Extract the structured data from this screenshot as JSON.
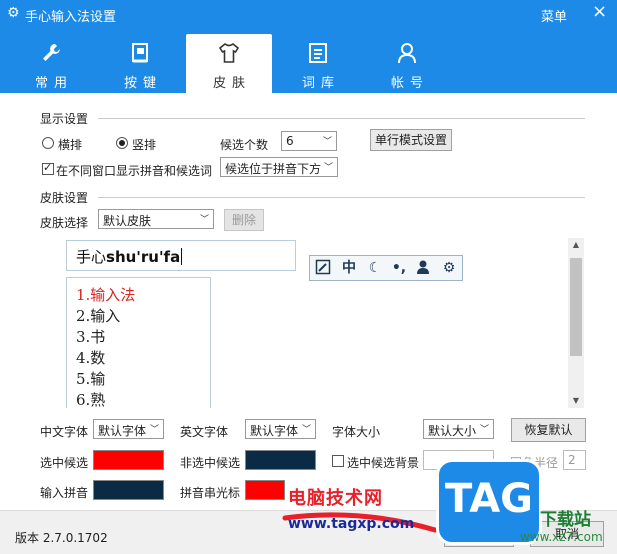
{
  "window": {
    "title": "手心输入法设置",
    "menu_label": "菜单",
    "close_glyph": "×"
  },
  "tabs": [
    {
      "label": "常用",
      "icon": "wrench-icon"
    },
    {
      "label": "按键",
      "icon": "keyboard-icon"
    },
    {
      "label": "皮肤",
      "icon": "tshirt-icon",
      "active": true
    },
    {
      "label": "词库",
      "icon": "book-icon"
    },
    {
      "label": "帐号",
      "icon": "user-icon"
    }
  ],
  "display": {
    "section_title": "显示设置",
    "horizontal_label": "横排",
    "vertical_label": "竖排",
    "orientation_selected": "竖排",
    "candidate_count_label": "候选个数",
    "candidate_count_value": "6",
    "single_line_button": "单行模式设置",
    "show_in_window_label": "在不同窗口显示拼音和候选词",
    "show_in_window_checked": true,
    "position_value": "候选位于拼音下方"
  },
  "skin": {
    "section_title": "皮肤设置",
    "select_label": "皮肤选择",
    "select_value": "默认皮肤",
    "delete_button": "删除"
  },
  "preview": {
    "composition_prefix": "手心",
    "composition_pinyin": "shu'ru'fa",
    "status_icons": [
      "skin-icon",
      "chinese-mode-icon",
      "moon-icon",
      "punctuation-icon",
      "user-icon",
      "gear-icon"
    ],
    "status_chinese_glyph": "中",
    "candidates": [
      "1.输入法",
      "2.输入",
      "3.书",
      "4.数",
      "5.输",
      "6.熟"
    ]
  },
  "fonts": {
    "cn_font_label": "中文字体",
    "cn_font_value": "默认字体",
    "en_font_label": "英文字体",
    "en_font_value": "默认字体",
    "size_label": "字体大小",
    "size_value": "默认大小",
    "restore_button": "恢复默认"
  },
  "colors": {
    "selected_candidate_label": "选中候选",
    "selected_candidate_color": "#ff0000",
    "unselected_candidate_label": "非选中候选",
    "unselected_candidate_color": "#0b2a45",
    "selected_bg_label": "选中候选背景",
    "selected_bg_checked": false,
    "corner_radius_label": "圆角半径",
    "corner_radius_value": "2",
    "input_pinyin_label": "输入拼音",
    "input_pinyin_color": "#0b2a45",
    "pinyin_cursor_label": "拼音串光标",
    "pinyin_cursor_color": "#ff0000"
  },
  "footer": {
    "version_text": "版本 2.7.0.1702",
    "ok_button": "确定",
    "cancel_button": "取消"
  },
  "watermark": {
    "site_name": "电脑技术网",
    "url": "www.tagxp.com",
    "tag_text": "TAG",
    "download_text": "下载站",
    "xz_url": "www.xz7.com"
  },
  "accent_color": "#1c8ae6"
}
